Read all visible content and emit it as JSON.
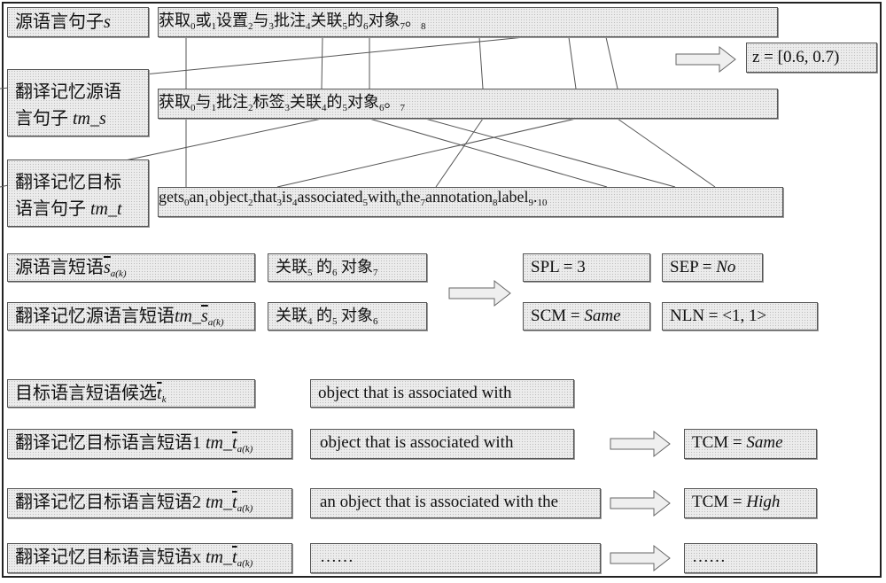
{
  "source_sentence": {
    "label": "源语言句子",
    "var": "s",
    "tokens": [
      {
        "w": "获取",
        "i": "0"
      },
      {
        "w": "或",
        "i": "1"
      },
      {
        "w": "设置",
        "i": "2"
      },
      {
        "w": "与",
        "i": "3"
      },
      {
        "w": "批注",
        "i": "4"
      },
      {
        "w": "关联",
        "i": "5"
      },
      {
        "w": "的",
        "i": "6"
      },
      {
        "w": "对象",
        "i": "7"
      },
      {
        "w": "。",
        "i": "8"
      }
    ]
  },
  "tm_source_sentence": {
    "label_line1": "翻译记忆源语",
    "label_line2": "言句子 ",
    "var": "tm_s",
    "tokens": [
      {
        "w": "获取",
        "i": "0"
      },
      {
        "w": "与",
        "i": "1"
      },
      {
        "w": "批注",
        "i": "2"
      },
      {
        "w": "标签",
        "i": "3"
      },
      {
        "w": "关联",
        "i": "4"
      },
      {
        "w": "的",
        "i": "5"
      },
      {
        "w": "对象",
        "i": "6"
      },
      {
        "w": "。",
        "i": "7"
      }
    ]
  },
  "tm_target_sentence": {
    "label_line1": "翻译记忆目标",
    "label_line2": "语言句子 ",
    "var": "tm_t",
    "tokens": [
      {
        "w": "gets",
        "i": "0"
      },
      {
        "w": "an",
        "i": "1"
      },
      {
        "w": "object",
        "i": "2"
      },
      {
        "w": "that",
        "i": "3"
      },
      {
        "w": "is",
        "i": "4"
      },
      {
        "w": "associated",
        "i": "5"
      },
      {
        "w": "with",
        "i": "6"
      },
      {
        "w": "the",
        "i": "7"
      },
      {
        "w": "annotation",
        "i": "8"
      },
      {
        "w": "label",
        "i": "9"
      },
      {
        "w": ".",
        "i": "10"
      }
    ]
  },
  "fuzzy_match": {
    "text": "z = [0.6, 0.7)"
  },
  "alignments": {
    "s_to_tms": [
      [
        0,
        0
      ],
      [
        3,
        1
      ],
      [
        4,
        2
      ],
      [
        5,
        4
      ],
      [
        6,
        5
      ],
      [
        7,
        6
      ],
      [
        8,
        7
      ]
    ],
    "tms_to_tmt": [
      [
        0,
        0
      ],
      [
        1,
        6
      ],
      [
        2,
        8
      ],
      [
        3,
        9
      ],
      [
        4,
        5
      ],
      [
        6,
        2
      ],
      [
        7,
        10
      ]
    ]
  },
  "phrases": {
    "src_phrase_label": "源语言短语",
    "src_phrase_var": "s",
    "src_phrase_sub": "a(k)",
    "src_phrase_value": [
      {
        "w": "关联",
        "i": "5"
      },
      {
        "w": "的",
        "i": "6"
      },
      {
        "w": "对象",
        "i": "7"
      }
    ],
    "tm_src_phrase_label": "翻译记忆源语言短语",
    "tm_src_phrase_var_prefix": "tm_",
    "tm_src_phrase_var": "s",
    "tm_src_phrase_sub": "a(k)",
    "tm_src_phrase_value": [
      {
        "w": "关联",
        "i": "4"
      },
      {
        "w": "的",
        "i": "5"
      },
      {
        "w": "对象",
        "i": "6"
      }
    ]
  },
  "features": {
    "spl": {
      "name": "SPL = ",
      "value": "3"
    },
    "sep": {
      "name": "SEP = ",
      "value": "No"
    },
    "scm": {
      "name": "SCM = ",
      "value": "Same"
    },
    "nln": {
      "name": "NLN = ",
      "value": "<1, 1>"
    }
  },
  "target_candidates": {
    "candidate_label": "目标语言短语候选",
    "candidate_var": "t",
    "candidate_sub": "k",
    "candidate_value": "object that is associated with",
    "rows": [
      {
        "label": "翻译记忆目标语言短语1 ",
        "var_prefix": "tm_",
        "var": "t",
        "sub": "a(k)",
        "value": "object that is associated with",
        "tcm_name": "TCM = ",
        "tcm_value": "Same"
      },
      {
        "label": "翻译记忆目标语言短语2 ",
        "var_prefix": "tm_",
        "var": "t",
        "sub": "a(k)",
        "value": "an object that is associated with the",
        "tcm_name": "TCM = ",
        "tcm_value": "High"
      },
      {
        "label": "翻译记忆目标语言短语x ",
        "var_prefix": "tm_",
        "var": "t",
        "sub": "a(k)",
        "value": "……",
        "tcm_name": "",
        "tcm_value": "……"
      }
    ]
  }
}
